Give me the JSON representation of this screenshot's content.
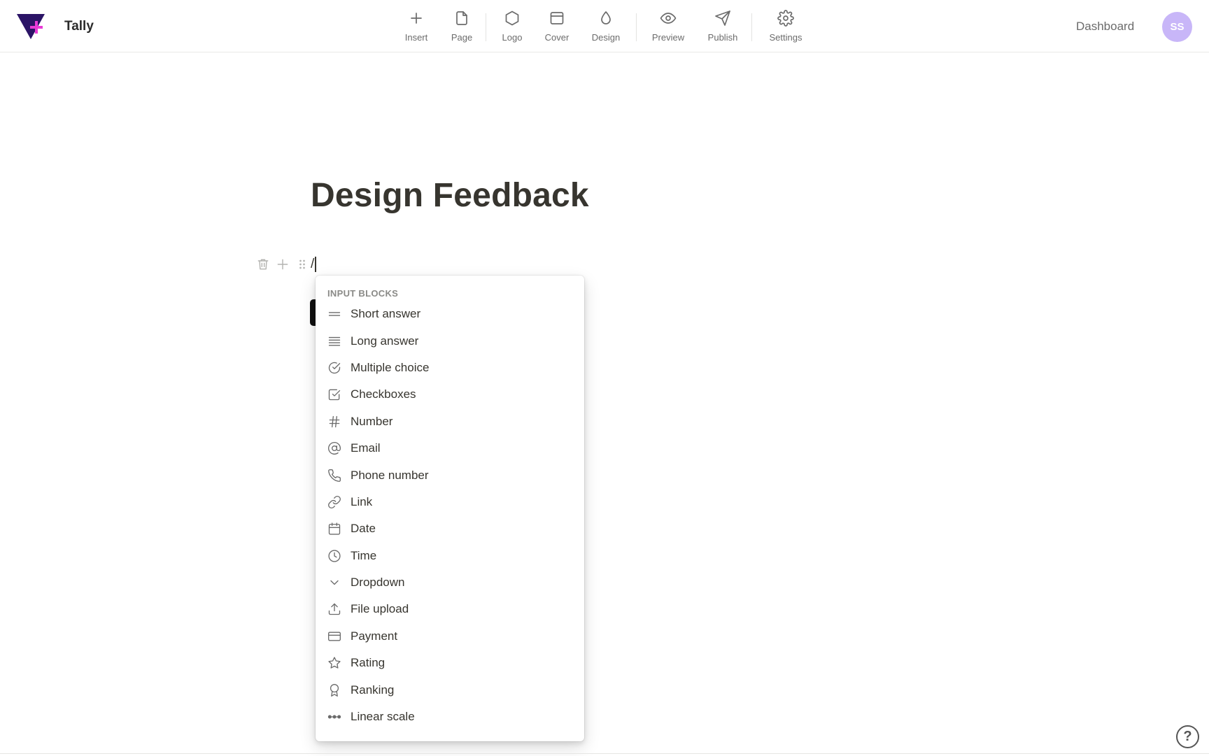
{
  "app": {
    "name": "Tally",
    "brand_color": "#2b1466",
    "accent": "#e83ad6"
  },
  "toolbar": {
    "items": [
      {
        "label": "Insert",
        "icon": "plus-icon"
      },
      {
        "label": "Page",
        "icon": "page-icon"
      },
      {
        "label": "Logo",
        "icon": "hexagon-icon"
      },
      {
        "label": "Cover",
        "icon": "cover-icon"
      },
      {
        "label": "Design",
        "icon": "droplet-icon"
      },
      {
        "label": "Preview",
        "icon": "eye-icon"
      },
      {
        "label": "Publish",
        "icon": "send-icon"
      },
      {
        "label": "Settings",
        "icon": "gear-icon"
      }
    ]
  },
  "header": {
    "dashboard_label": "Dashboard",
    "avatar_initials": "SS",
    "avatar_color": "#c8b6f8"
  },
  "editor": {
    "title": "Design Feedback",
    "slash_text": "/"
  },
  "menu": {
    "header": "INPUT BLOCKS",
    "items": [
      {
        "label": "Short answer",
        "icon": "short-answer-icon"
      },
      {
        "label": "Long answer",
        "icon": "long-answer-icon"
      },
      {
        "label": "Multiple choice",
        "icon": "circle-check-icon"
      },
      {
        "label": "Checkboxes",
        "icon": "checkbox-icon"
      },
      {
        "label": "Number",
        "icon": "hash-icon"
      },
      {
        "label": "Email",
        "icon": "at-icon"
      },
      {
        "label": "Phone number",
        "icon": "phone-icon"
      },
      {
        "label": "Link",
        "icon": "link-icon"
      },
      {
        "label": "Date",
        "icon": "calendar-icon"
      },
      {
        "label": "Time",
        "icon": "clock-icon"
      },
      {
        "label": "Dropdown",
        "icon": "chevron-down-icon"
      },
      {
        "label": "File upload",
        "icon": "upload-icon"
      },
      {
        "label": "Payment",
        "icon": "credit-card-icon"
      },
      {
        "label": "Rating",
        "icon": "star-icon"
      },
      {
        "label": "Ranking",
        "icon": "award-icon"
      },
      {
        "label": "Linear scale",
        "icon": "linear-scale-icon"
      }
    ]
  },
  "help": {
    "symbol": "?"
  }
}
